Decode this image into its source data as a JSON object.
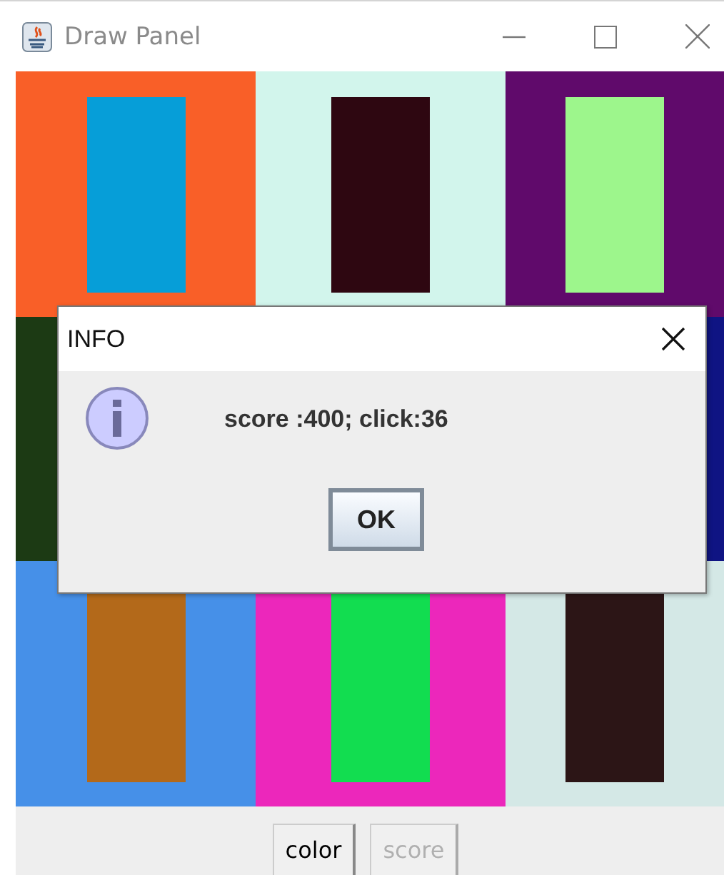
{
  "window": {
    "title": "Draw Panel"
  },
  "grid": [
    [
      {
        "kind": "bar",
        "color": "#f95f28",
        "bar": {
          "color": "#069ed8"
        }
      },
      {
        "kind": "bar",
        "color": "#d2f5ec",
        "bar": {
          "color": "#2e0711"
        }
      },
      {
        "kind": "bar",
        "color": "#600a6b",
        "bar": {
          "color": "#9df68c"
        }
      }
    ],
    [
      {
        "kind": "plain",
        "color": "#1c3a14"
      },
      {
        "kind": "covered"
      },
      {
        "kind": "plain",
        "color": "#0f1483"
      }
    ],
    [
      {
        "kind": "bar",
        "color": "#4690e8",
        "bar": {
          "color": "#b3691a"
        }
      },
      {
        "kind": "bar",
        "color": "#ec27bb",
        "bar": {
          "color": "#12dd50"
        }
      },
      {
        "kind": "bar",
        "color": "#d4e8e6",
        "bar": {
          "color": "#2c1516"
        }
      }
    ]
  ],
  "buttons": [
    {
      "label": "color",
      "disabled": false
    },
    {
      "label": "score",
      "disabled": true
    }
  ],
  "dialog": {
    "title": "INFO",
    "message": "score :400; click:36",
    "button": "OK"
  }
}
